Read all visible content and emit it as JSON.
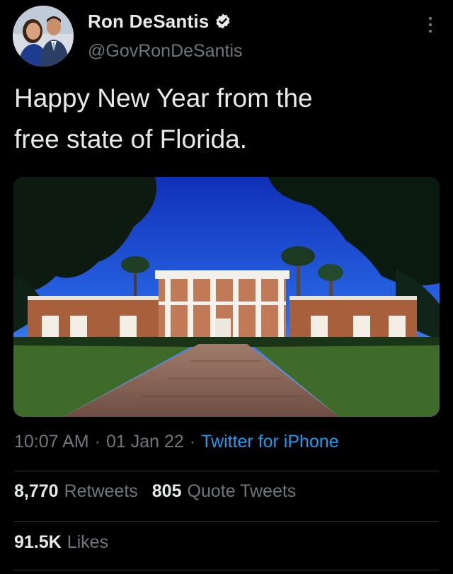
{
  "tweet": {
    "author": {
      "display_name": "Ron DeSantis",
      "handle": "@GovRonDeSantis",
      "verified": true,
      "avatar_icon": "profile-photo"
    },
    "text": "Happy New Year from the\nfree state of Florida.",
    "media": {
      "type": "photo",
      "icon": "governors-mansion-photo"
    },
    "time": "10:07 AM",
    "date": "01 Jan 22",
    "separator": "·",
    "source": "Twitter for iPhone",
    "stats": {
      "retweets_count": "8,770",
      "retweets_label": "Retweets",
      "quote_tweets_count": "805",
      "quote_tweets_label": "Quote Tweets",
      "likes_count": "91.5K",
      "likes_label": "Likes"
    }
  },
  "colors": {
    "background": "#000000",
    "primary_text": "#e7e9ea",
    "secondary_text": "#71767b",
    "link": "#1d9bf0",
    "divider": "#2f3336",
    "verified_badge": "#e7e9ea"
  }
}
